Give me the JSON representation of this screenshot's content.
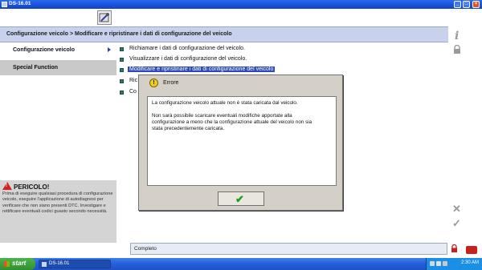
{
  "window": {
    "title": "DS-16.01"
  },
  "breadcrumb": "Configurazione veicolo > Modificare e ripristinare i dati di configurazione del veicolo",
  "sidebar": {
    "items": [
      {
        "label": "Configurazione veicolo"
      },
      {
        "label": "Special Function"
      }
    ]
  },
  "danger": {
    "title": "PERICOLO!",
    "text": "Prima di eseguire qualsiasi procedura di configurazione veicolo, eseguire l'applicazione di autodiagnosi per verificare che non siano presenti DTC. Investigare e rettificare eventuali codici guasto secondo necessità."
  },
  "menu": {
    "items": [
      {
        "label": "Richiamare i dati di configurazione del veicolo."
      },
      {
        "label": "Visualizzare i dati di configurazione del veicolo."
      },
      {
        "label": "Modificare e ripristinare i dati di configurazione del veicolo"
      },
      {
        "label": "Ric"
      },
      {
        "label": "Co"
      }
    ]
  },
  "dialog": {
    "title": "Errore",
    "message1": "La configurazione veicolo attuale non è stata caricata dal veicolo.",
    "message2": "Non sarà possibile scaricare eventuali modifiche apportate alla configurazione a meno che la configurazione attuale del veicolo non sia stata precedentemente caricata.",
    "ok_icon": "check-icon"
  },
  "status": {
    "text": "Completo"
  },
  "taskbar": {
    "start_label": "start",
    "task_label": "DS-16.01",
    "clock": "2:30 AM"
  },
  "colors": {
    "breadcrumb_bg": "#c8d2ec",
    "selection": "#2c4ab8",
    "taskbar": "#245ed8",
    "danger_red": "#d62020"
  }
}
